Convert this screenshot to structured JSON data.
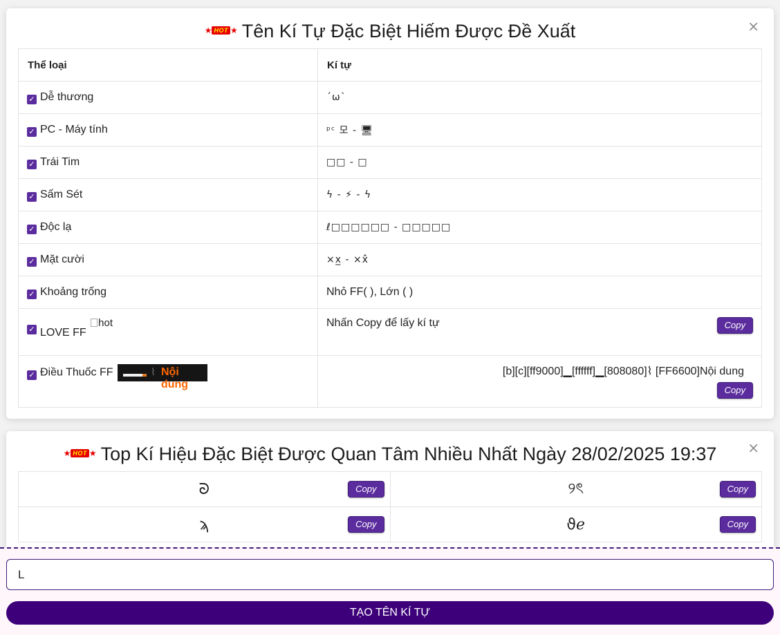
{
  "card1": {
    "hot_badge": "HOT",
    "title": "Tên Kí Tự Đặc Biệt Hiếm Được Đề Xuất",
    "close": "×",
    "headers": [
      "Thể loại",
      "Kí tự"
    ],
    "rows": [
      {
        "category": "Dễ thương",
        "chars": "ˊωˋ"
      },
      {
        "category": "PC - Máy tính",
        "chars": "ᵖᶜ 모 - 🖥"
      },
      {
        "category": "Trái Tim",
        "chars": "□□ - □"
      },
      {
        "category": "Sấm Sét",
        "chars": "ϟ - ⚡ - ϟ"
      },
      {
        "category": "Độc lạ",
        "chars": "ℓ□□□□□□  - □□□□□"
      },
      {
        "category": "Mặt cười",
        "chars": "×x̲ - ×x̂"
      },
      {
        "category": "Khoảng trống",
        "chars": "Nhỏ FF( ), Lớn (    )"
      }
    ],
    "love": {
      "category": "LOVE FF",
      "img_alt": "hot",
      "chars": "Nhấn Copy để lấy kí tự",
      "copy": "Copy"
    },
    "smoke": {
      "category": "Điều Thuốc FF",
      "img_text": "Nội dung",
      "img_smoke": "⌇",
      "chars": "[b][c][ff9000]▁[ffffff]▁[808080]⌇ [FF6600]Nội dung",
      "copy": "Copy"
    }
  },
  "card2": {
    "hot_badge": "HOT",
    "title": "Top Kí Hiệu Đặc Biệt Được Quan Tâm Nhiều Nhất Ngày 28/02/2025 19:37",
    "close": "×",
    "items": [
      {
        "symbol": "ᘐ",
        "copy": "Copy"
      },
      {
        "symbol": "୨ৎ",
        "copy": "Copy"
      },
      {
        "symbol": "ϡ",
        "copy": "Copy"
      },
      {
        "symbol": "ϑℯ",
        "copy": "Copy"
      }
    ]
  },
  "footer": {
    "input_value": "L",
    "button": "TẠO TÊN KÍ TỰ"
  },
  "colors": {
    "accent": "#5b2c9e",
    "primary_dark": "#3d007a",
    "hot_red": "#e60000"
  }
}
